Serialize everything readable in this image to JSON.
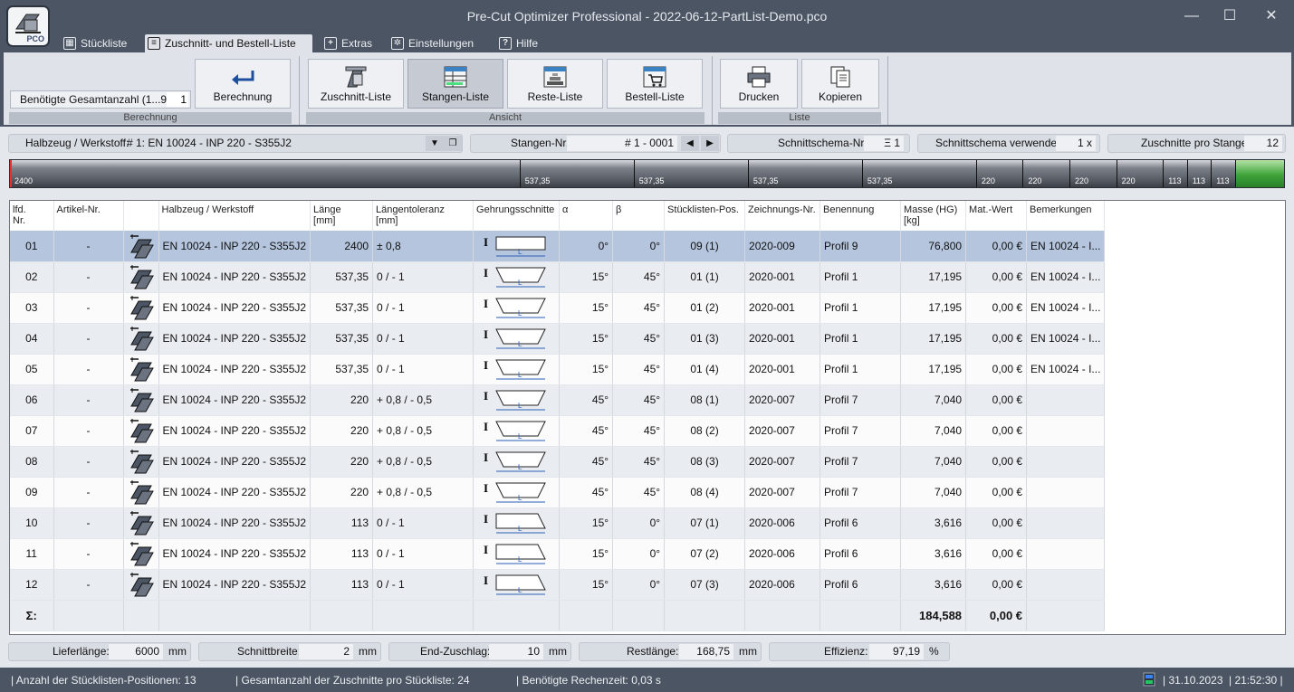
{
  "window": {
    "title": "Pre-Cut Optimizer Professional - 2022-06-12-PartList-Demo.pco",
    "logo_text": "PCO",
    "minimize": "—",
    "maximize": "☐",
    "close": "✕"
  },
  "menu": {
    "tabs": [
      {
        "label": "Stückliste",
        "icon": "table-icon"
      },
      {
        "label": "Zuschnitt- und Bestell-Liste",
        "icon": "cut-list-icon"
      },
      {
        "label": "Extras",
        "icon": "plus-icon"
      },
      {
        "label": "Einstellungen",
        "icon": "gear-icon"
      },
      {
        "label": "Hilfe",
        "icon": "help-icon"
      }
    ],
    "active_index": 1
  },
  "ribbon": {
    "qty_label": "Benötigte Gesamtanzahl (1...99):",
    "qty_value": "1",
    "berechnung_button": "Berechnung",
    "group_berechnung": "Berechnung",
    "zuschnitt_liste": "Zuschnitt-Liste",
    "stangen_liste": "Stangen-Liste",
    "reste_liste": "Reste-Liste",
    "bestell_liste": "Bestell-Liste",
    "group_ansicht": "Ansicht",
    "drucken": "Drucken",
    "kopieren": "Kopieren",
    "group_liste": "Liste"
  },
  "filters": {
    "halbzeug_label": "Halbzeug / Werkstoff:",
    "halbzeug_value": "# 1:  EN 10024 - INP 220 - S355J2",
    "stangen_label": "Stangen-Nr.:",
    "stangen_value": "# 1 - 0001",
    "schema_label": "Schnittschema-Nr.:",
    "schema_value": "Ξ 1",
    "verwendet_label": "Schnittschema verwendet:",
    "verwendet_value": "1 x",
    "zuschnitte_label": "Zuschnitte pro Stange:",
    "zuschnitte_value": "12"
  },
  "cutbar": {
    "bar_length": 6000,
    "segments": [
      2400,
      537.35,
      537.35,
      537.35,
      537.35,
      220,
      220,
      220,
      220,
      113,
      113,
      113
    ],
    "labels": [
      "2400",
      "537,35",
      "537,35",
      "537,35",
      "537,35",
      "220",
      "220",
      "220",
      "220",
      "113",
      "113",
      "113"
    ],
    "rest_color": "#3fa33a"
  },
  "table": {
    "headers": {
      "lfd": "lfd.\nNr.",
      "artikel": "Artikel-Nr.",
      "halbzeug": "Halbzeug / Werkstoff",
      "laenge": "Länge\n[mm]",
      "toleranz": "Längentoleranz\n[mm]",
      "gehrung": "Gehrungsschnitte",
      "alpha": "α",
      "beta": "β",
      "pos": "Stücklisten-Pos.",
      "zeichnung": "Zeichnungs-Nr.",
      "benennung": "Benennung",
      "masse": "Masse (HG)\n[kg]",
      "matwert": "Mat.-Wert",
      "bemerkungen": "Bemerkungen"
    },
    "rows": [
      {
        "lfd": "01",
        "artikel": "-",
        "halbzeug": "EN 10024 - INP 220 - S355J2",
        "laenge": "2400",
        "toleranz": "± 0,8",
        "miter": "straight",
        "alpha": "0°",
        "beta": "0°",
        "pos": "09 (1)",
        "zeichnung": "2020-009",
        "benennung": "Profil 9",
        "masse": "76,800",
        "matwert": "0,00 €",
        "bemerkungen": "EN 10024 - I..."
      },
      {
        "lfd": "02",
        "artikel": "-",
        "halbzeug": "EN 10024 - INP 220 - S355J2",
        "laenge": "537,35",
        "toleranz": "0 / - 1",
        "miter": "double",
        "alpha": "15°",
        "beta": "45°",
        "pos": "01 (1)",
        "zeichnung": "2020-001",
        "benennung": "Profil 1",
        "masse": "17,195",
        "matwert": "0,00 €",
        "bemerkungen": "EN 10024 - I..."
      },
      {
        "lfd": "03",
        "artikel": "-",
        "halbzeug": "EN 10024 - INP 220 - S355J2",
        "laenge": "537,35",
        "toleranz": "0 / - 1",
        "miter": "double",
        "alpha": "15°",
        "beta": "45°",
        "pos": "01 (2)",
        "zeichnung": "2020-001",
        "benennung": "Profil 1",
        "masse": "17,195",
        "matwert": "0,00 €",
        "bemerkungen": "EN 10024 - I..."
      },
      {
        "lfd": "04",
        "artikel": "-",
        "halbzeug": "EN 10024 - INP 220 - S355J2",
        "laenge": "537,35",
        "toleranz": "0 / - 1",
        "miter": "double",
        "alpha": "15°",
        "beta": "45°",
        "pos": "01 (3)",
        "zeichnung": "2020-001",
        "benennung": "Profil 1",
        "masse": "17,195",
        "matwert": "0,00 €",
        "bemerkungen": "EN 10024 - I..."
      },
      {
        "lfd": "05",
        "artikel": "-",
        "halbzeug": "EN 10024 - INP 220 - S355J2",
        "laenge": "537,35",
        "toleranz": "0 / - 1",
        "miter": "double",
        "alpha": "15°",
        "beta": "45°",
        "pos": "01 (4)",
        "zeichnung": "2020-001",
        "benennung": "Profil 1",
        "masse": "17,195",
        "matwert": "0,00 €",
        "bemerkungen": "EN 10024 - I..."
      },
      {
        "lfd": "06",
        "artikel": "-",
        "halbzeug": "EN 10024 - INP 220 - S355J2",
        "laenge": "220",
        "toleranz": "+ 0,8 / - 0,5",
        "miter": "double",
        "alpha": "45°",
        "beta": "45°",
        "pos": "08 (1)",
        "zeichnung": "2020-007",
        "benennung": "Profil 7",
        "masse": "7,040",
        "matwert": "0,00 €",
        "bemerkungen": ""
      },
      {
        "lfd": "07",
        "artikel": "-",
        "halbzeug": "EN 10024 - INP 220 - S355J2",
        "laenge": "220",
        "toleranz": "+ 0,8 / - 0,5",
        "miter": "double",
        "alpha": "45°",
        "beta": "45°",
        "pos": "08 (2)",
        "zeichnung": "2020-007",
        "benennung": "Profil 7",
        "masse": "7,040",
        "matwert": "0,00 €",
        "bemerkungen": ""
      },
      {
        "lfd": "08",
        "artikel": "-",
        "halbzeug": "EN 10024 - INP 220 - S355J2",
        "laenge": "220",
        "toleranz": "+ 0,8 / - 0,5",
        "miter": "double",
        "alpha": "45°",
        "beta": "45°",
        "pos": "08 (3)",
        "zeichnung": "2020-007",
        "benennung": "Profil 7",
        "masse": "7,040",
        "matwert": "0,00 €",
        "bemerkungen": ""
      },
      {
        "lfd": "09",
        "artikel": "-",
        "halbzeug": "EN 10024 - INP 220 - S355J2",
        "laenge": "220",
        "toleranz": "+ 0,8 / - 0,5",
        "miter": "double",
        "alpha": "45°",
        "beta": "45°",
        "pos": "08 (4)",
        "zeichnung": "2020-007",
        "benennung": "Profil 7",
        "masse": "7,040",
        "matwert": "0,00 €",
        "bemerkungen": ""
      },
      {
        "lfd": "10",
        "artikel": "-",
        "halbzeug": "EN 10024 - INP 220 - S355J2",
        "laenge": "113",
        "toleranz": "0 / - 1",
        "miter": "single",
        "alpha": "15°",
        "beta": "0°",
        "pos": "07 (1)",
        "zeichnung": "2020-006",
        "benennung": "Profil 6",
        "masse": "3,616",
        "matwert": "0,00 €",
        "bemerkungen": ""
      },
      {
        "lfd": "11",
        "artikel": "-",
        "halbzeug": "EN 10024 - INP 220 - S355J2",
        "laenge": "113",
        "toleranz": "0 / - 1",
        "miter": "single",
        "alpha": "15°",
        "beta": "0°",
        "pos": "07 (2)",
        "zeichnung": "2020-006",
        "benennung": "Profil 6",
        "masse": "3,616",
        "matwert": "0,00 €",
        "bemerkungen": ""
      },
      {
        "lfd": "12",
        "artikel": "-",
        "halbzeug": "EN 10024 - INP 220 - S355J2",
        "laenge": "113",
        "toleranz": "0 / - 1",
        "miter": "single",
        "alpha": "15°",
        "beta": "0°",
        "pos": "07 (3)",
        "zeichnung": "2020-006",
        "benennung": "Profil 6",
        "masse": "3,616",
        "matwert": "0,00 €",
        "bemerkungen": ""
      }
    ],
    "selected_index": 0,
    "sum_label": "Σ:",
    "sum_masse": "184,588",
    "sum_matwert": "0,00 €"
  },
  "bottom": {
    "lieferlaenge_label": "Lieferlänge:",
    "lieferlaenge_value": "6000",
    "schnittbreite_label": "Schnittbreite:",
    "schnittbreite_value": "2",
    "endzuschlag_label": "End-Zuschlag:",
    "endzuschlag_value": "10",
    "restlaenge_label": "Restlänge:",
    "restlaenge_value": "168,75",
    "effizienz_label": "Effizienz:",
    "effizienz_value": "97,19",
    "unit_mm": "mm",
    "unit_percent": "%"
  },
  "status": {
    "positions": "|  Anzahl der Stücklisten-Positionen:  13",
    "cuts": "|  Gesamtanzahl der Zuschnitte pro Stückliste:  24",
    "time": "|  Benötigte Rechenzeit:  0,03 s",
    "date": "|  31.10.2023",
    "clock": "|  21:52:30  |"
  }
}
